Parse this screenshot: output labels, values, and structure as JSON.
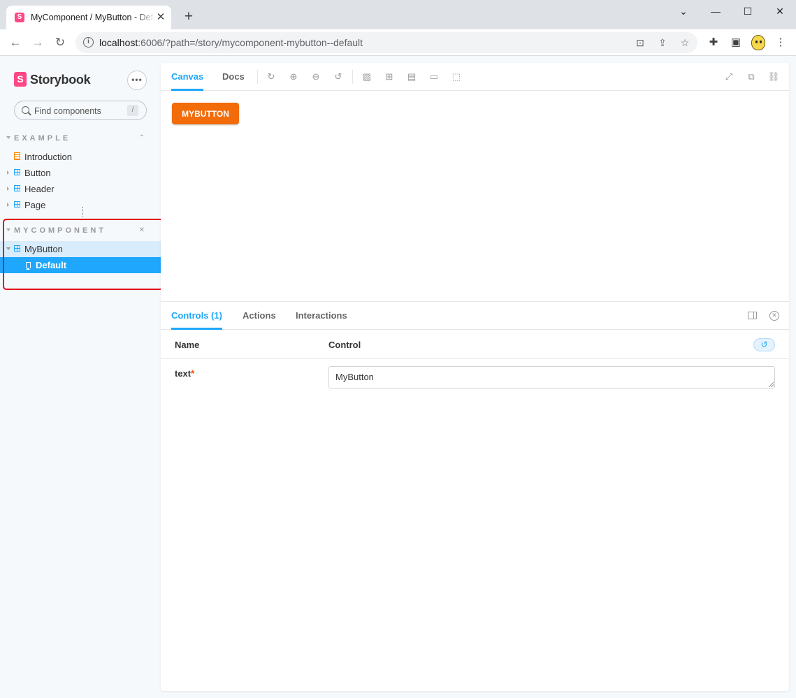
{
  "browser": {
    "tab_title": "MyComponent / MyButton - Default",
    "tab_favicon": "S",
    "close_glyph": "✕",
    "newtab_glyph": "+",
    "url_host": "localhost",
    "url_path": ":6006/?path=/story/mycomponent-mybutton--default",
    "controls": {
      "minimize": "—",
      "maximize": "☐",
      "close": "✕"
    }
  },
  "sidebar": {
    "logo_mark": "S",
    "logo_text": "Storybook",
    "menu_glyph": "•••",
    "search_placeholder": "Find components",
    "search_shortcut": "/",
    "groups": [
      {
        "label": "EXAMPLE",
        "toggle": "⌃⌄",
        "items": [
          {
            "label": "Introduction",
            "icon": "document-icon"
          },
          {
            "label": "Button",
            "icon": "component-icon"
          },
          {
            "label": "Header",
            "icon": "component-icon"
          },
          {
            "label": "Page",
            "icon": "component-icon"
          }
        ]
      },
      {
        "label": "MYCOMPONENT",
        "toggle": "⌄⌃",
        "items": [
          {
            "label": "MyButton",
            "icon": "component-icon"
          },
          {
            "label": "Default",
            "icon": "bookmark-icon",
            "selected": true
          }
        ]
      }
    ]
  },
  "toolbar": {
    "tabs": [
      "Canvas",
      "Docs"
    ],
    "active_tab": "Canvas"
  },
  "preview": {
    "button_label": "MYBUTTON",
    "button_color": "#f26c0a"
  },
  "addons": {
    "tabs": [
      "Controls (1)",
      "Actions",
      "Interactions"
    ],
    "active_tab": "Controls (1)",
    "table": {
      "headers": {
        "name": "Name",
        "control": "Control"
      },
      "reset_glyph": "↺",
      "rows": [
        {
          "name": "text",
          "required_mark": "*",
          "value": "MyButton"
        }
      ]
    }
  },
  "colors": {
    "accent": "#1ea7fd",
    "brand": "#ff4785",
    "highlight_border": "#e0101a"
  }
}
